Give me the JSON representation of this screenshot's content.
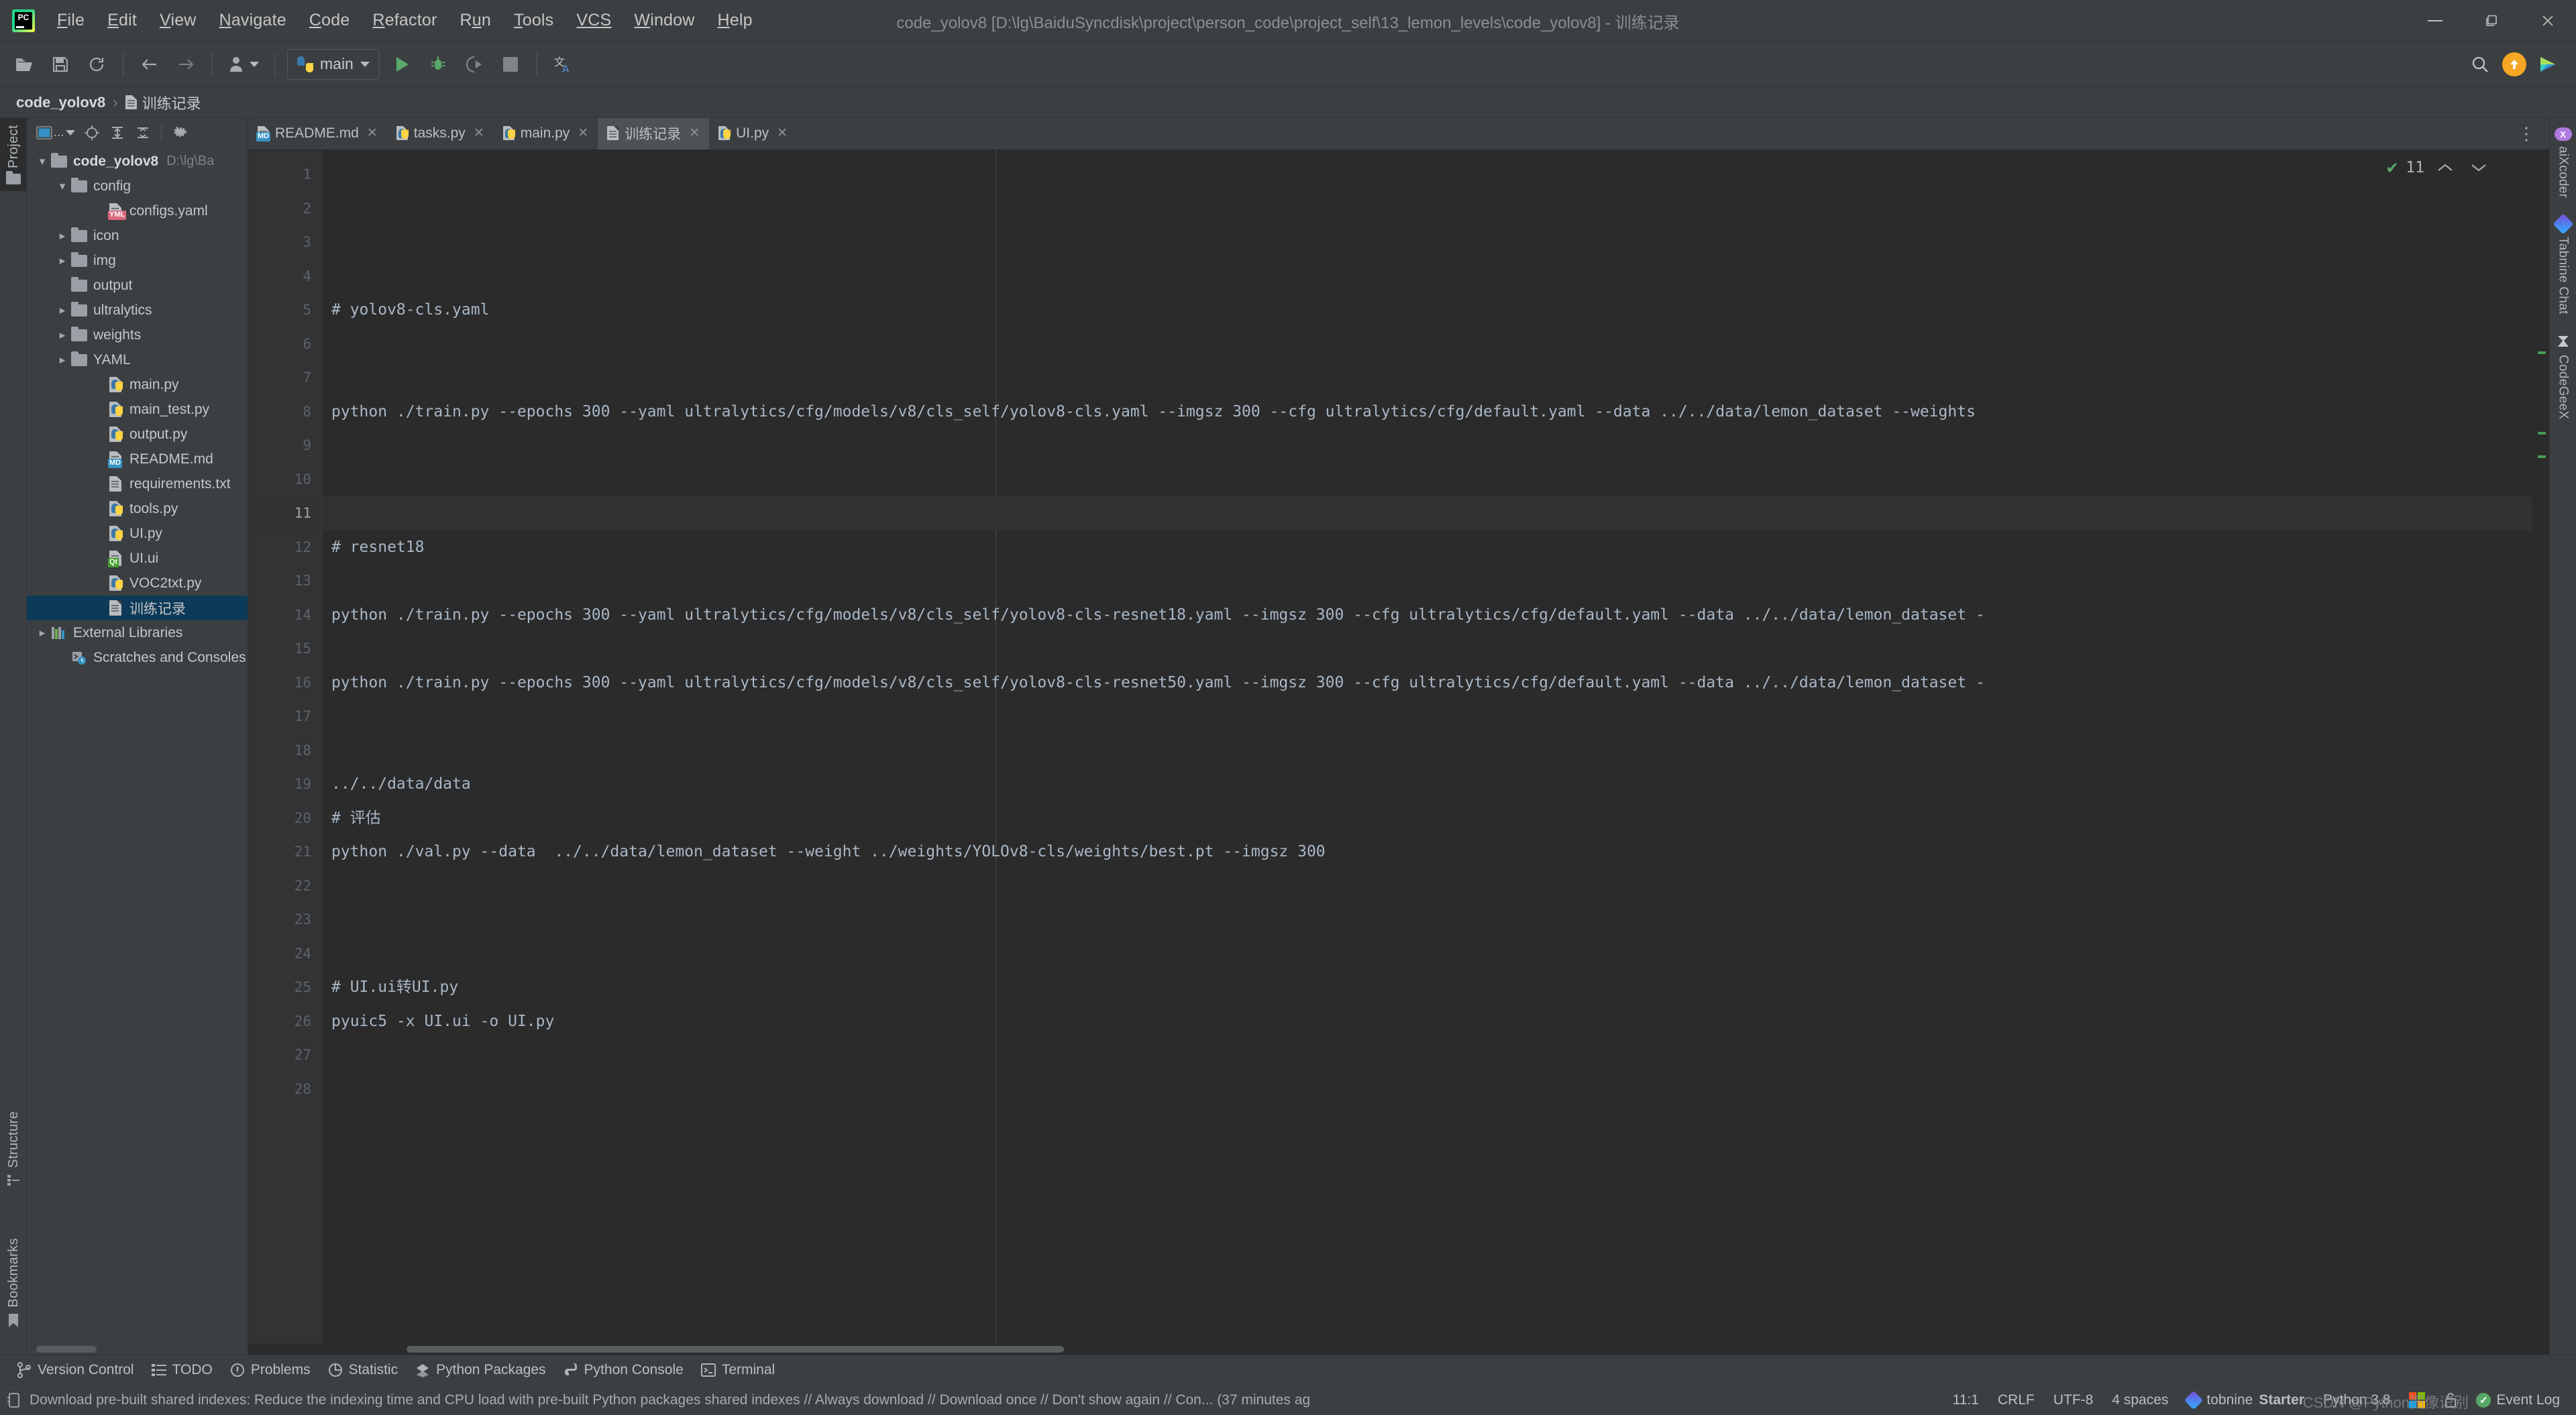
{
  "window": {
    "title": "code_yolov8 [D:\\lg\\BaiduSyncdisk\\project\\person_code\\project_self\\13_lemon_levels\\code_yolov8] - 训练记录",
    "minimize": "—",
    "maximize": "❐",
    "close": "✕"
  },
  "menu": {
    "items": [
      "File",
      "Edit",
      "View",
      "Navigate",
      "Code",
      "Refactor",
      "Run",
      "Tools",
      "VCS",
      "Window",
      "Help"
    ]
  },
  "toolbar": {
    "run_config": "main",
    "icons": [
      "open-folder-icon",
      "save-all-icon",
      "sync-icon",
      "back-arrow-icon",
      "forward-arrow-icon",
      "profile-icon",
      "run-icon",
      "debug-icon",
      "run-coverage-icon",
      "stop-icon",
      "translate-icon"
    ],
    "right_icons": [
      "search-everywhere-icon",
      "update-available-icon",
      "tabnine-icon"
    ]
  },
  "breadcrumb": {
    "project": "code_yolov8",
    "separator": "›",
    "file": "训练记录"
  },
  "left_tabs": [
    {
      "label": "Project",
      "active": true
    },
    {
      "label": "Structure",
      "active": false
    },
    {
      "label": "Bookmarks",
      "active": false
    }
  ],
  "right_tabs": [
    {
      "label": "aiXcoder"
    },
    {
      "label": "Tabnine Chat"
    },
    {
      "label": "CodeGeeX"
    }
  ],
  "project_tree": {
    "toolbar_icons": [
      "project-view-selector",
      "locate-icon",
      "expand-all-icon",
      "collapse-all-icon",
      "settings-gear-icon"
    ],
    "selector_label": "...",
    "nodes": [
      {
        "label": "code_yolov8",
        "sub": "D:\\lg\\Ba",
        "indent": 0,
        "arrow": "down",
        "icon": "folder",
        "bold": true
      },
      {
        "label": "config",
        "sub": "",
        "indent": 1,
        "arrow": "down",
        "icon": "folder",
        "bold": false
      },
      {
        "label": "configs.yaml",
        "sub": "",
        "indent": 2,
        "arrow": "none",
        "icon": "yml",
        "bold": false
      },
      {
        "label": "icon",
        "sub": "",
        "indent": 1,
        "arrow": "right",
        "icon": "folder",
        "bold": false
      },
      {
        "label": "img",
        "sub": "",
        "indent": 1,
        "arrow": "right",
        "icon": "folder",
        "bold": false
      },
      {
        "label": "output",
        "sub": "",
        "indent": 1,
        "arrow": "none",
        "icon": "folder",
        "bold": false
      },
      {
        "label": "ultralytics",
        "sub": "",
        "indent": 1,
        "arrow": "right",
        "icon": "folder",
        "bold": false
      },
      {
        "label": "weights",
        "sub": "",
        "indent": 1,
        "arrow": "right",
        "icon": "folder",
        "bold": false
      },
      {
        "label": "YAML",
        "sub": "",
        "indent": 1,
        "arrow": "right",
        "icon": "folder",
        "bold": false
      },
      {
        "label": "main.py",
        "sub": "",
        "indent": 2,
        "arrow": "none",
        "icon": "py",
        "bold": false
      },
      {
        "label": "main_test.py",
        "sub": "",
        "indent": 2,
        "arrow": "none",
        "icon": "py",
        "bold": false
      },
      {
        "label": "output.py",
        "sub": "",
        "indent": 2,
        "arrow": "none",
        "icon": "py",
        "bold": false
      },
      {
        "label": "README.md",
        "sub": "",
        "indent": 2,
        "arrow": "none",
        "icon": "md",
        "bold": false
      },
      {
        "label": "requirements.txt",
        "sub": "",
        "indent": 2,
        "arrow": "none",
        "icon": "txt",
        "bold": false
      },
      {
        "label": "tools.py",
        "sub": "",
        "indent": 2,
        "arrow": "none",
        "icon": "py",
        "bold": false
      },
      {
        "label": "UI.py",
        "sub": "",
        "indent": 2,
        "arrow": "none",
        "icon": "py",
        "bold": false
      },
      {
        "label": "UI.ui",
        "sub": "",
        "indent": 2,
        "arrow": "none",
        "icon": "qt",
        "bold": false
      },
      {
        "label": "VOC2txt.py",
        "sub": "",
        "indent": 2,
        "arrow": "none",
        "icon": "py",
        "bold": false
      },
      {
        "label": "训练记录",
        "sub": "",
        "indent": 2,
        "arrow": "none",
        "icon": "txt",
        "bold": false,
        "selected": true
      },
      {
        "label": "External Libraries",
        "sub": "",
        "indent": 0,
        "arrow": "right",
        "icon": "libs",
        "bold": false
      },
      {
        "label": "Scratches and Consoles",
        "sub": "",
        "indent": 0,
        "arrow": "none",
        "icon": "scratch",
        "bold": false
      }
    ]
  },
  "editor_tabs": [
    {
      "label": "README.md",
      "icon": "md",
      "active": false,
      "close": "✕"
    },
    {
      "label": "tasks.py",
      "icon": "py",
      "active": false,
      "close": "✕"
    },
    {
      "label": "main.py",
      "icon": "py",
      "active": false,
      "close": "✕"
    },
    {
      "label": "训练记录",
      "icon": "txt",
      "active": true,
      "close": "✕"
    },
    {
      "label": "UI.py",
      "icon": "py",
      "active": false,
      "close": "✕"
    }
  ],
  "inspection": {
    "count": "11",
    "check_icon": "inspection-ok-icon",
    "prev": "⌃",
    "next": "⌄"
  },
  "code": {
    "current_line": 11,
    "lines": [
      {
        "n": 1,
        "text": ""
      },
      {
        "n": 2,
        "text": ""
      },
      {
        "n": 3,
        "text": ""
      },
      {
        "n": 4,
        "text": ""
      },
      {
        "n": 5,
        "text": "# yolov8-cls.yaml"
      },
      {
        "n": 6,
        "text": ""
      },
      {
        "n": 7,
        "text": ""
      },
      {
        "n": 8,
        "text": "python ./train.py --epochs 300 --yaml ultralytics/cfg/models/v8/cls_self/yolov8-cls.yaml --imgsz 300 --cfg ultralytics/cfg/default.yaml --data ../../data/lemon_dataset --weights"
      },
      {
        "n": 9,
        "text": ""
      },
      {
        "n": 10,
        "text": ""
      },
      {
        "n": 11,
        "text": ""
      },
      {
        "n": 12,
        "text": "# resnet18"
      },
      {
        "n": 13,
        "text": ""
      },
      {
        "n": 14,
        "text": "python ./train.py --epochs 300 --yaml ultralytics/cfg/models/v8/cls_self/yolov8-cls-resnet18.yaml --imgsz 300 --cfg ultralytics/cfg/default.yaml --data ../../data/lemon_dataset -"
      },
      {
        "n": 15,
        "text": ""
      },
      {
        "n": 16,
        "text": "python ./train.py --epochs 300 --yaml ultralytics/cfg/models/v8/cls_self/yolov8-cls-resnet50.yaml --imgsz 300 --cfg ultralytics/cfg/default.yaml --data ../../data/lemon_dataset -"
      },
      {
        "n": 17,
        "text": ""
      },
      {
        "n": 18,
        "text": ""
      },
      {
        "n": 19,
        "text": "../../data/data"
      },
      {
        "n": 20,
        "text": "# 评估"
      },
      {
        "n": 21,
        "text": "python ./val.py --data  ../../data/lemon_dataset --weight ../weights/YOLOv8-cls/weights/best.pt --imgsz 300"
      },
      {
        "n": 22,
        "text": ""
      },
      {
        "n": 23,
        "text": ""
      },
      {
        "n": 24,
        "text": ""
      },
      {
        "n": 25,
        "text": "# UI.ui转UI.py"
      },
      {
        "n": 26,
        "text": "pyuic5 -x UI.ui -o UI.py"
      },
      {
        "n": 27,
        "text": ""
      },
      {
        "n": 28,
        "text": ""
      }
    ]
  },
  "bottom_tools": [
    {
      "label": "Version Control",
      "icon": "branch-icon"
    },
    {
      "label": "TODO",
      "icon": "todo-list-icon"
    },
    {
      "label": "Problems",
      "icon": "problems-icon"
    },
    {
      "label": "Statistic",
      "icon": "statistic-icon"
    },
    {
      "label": "Python Packages",
      "icon": "packages-icon"
    },
    {
      "label": "Python Console",
      "icon": "python-console-icon"
    },
    {
      "label": "Terminal",
      "icon": "terminal-icon"
    }
  ],
  "status_bar": {
    "message_icon": "notification-icon",
    "message": "Download pre-built shared indexes: Reduce the indexing time and CPU load with pre-built Python packages shared indexes // Always download // Download once // Don't show again // Con... (37 minutes ag",
    "caret_position": "11:1",
    "line_separator": "CRLF",
    "encoding": "UTF-8",
    "indent": "4 spaces",
    "tabnine": "tobnine",
    "tabnine_plan": "Starter",
    "interpreter": "Python 3.8",
    "event_log": "Event Log",
    "lock_icon": "lock-icon",
    "watermark": "CSDN @Python图像识别"
  },
  "colors": {
    "bg": "#3c3f41",
    "editor_bg": "#2b2b2b",
    "gutter_bg": "#313335",
    "selection": "#0d3a58",
    "text": "#a9b7c6",
    "accent_green": "#59a869",
    "accent_orange": "#f5a623"
  }
}
